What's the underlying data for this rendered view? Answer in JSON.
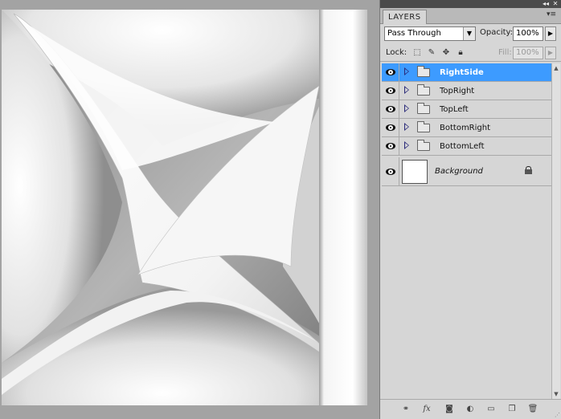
{
  "panel": {
    "collapse_icon": "double-chevron-left-icon",
    "close_icon": "close-icon",
    "tab_label": "LAYERS",
    "menu_icon": "panel-menu-icon"
  },
  "blend": {
    "mode": "Pass Through",
    "opacity_label": "Opacity:",
    "opacity_value": "100%"
  },
  "lock": {
    "label": "Lock:",
    "fill_label": "Fill:",
    "fill_value": "100%",
    "icons": [
      "lock-transparent-icon",
      "lock-image-icon",
      "lock-position-icon",
      "lock-all-icon"
    ]
  },
  "layers": [
    {
      "name": "RightSide",
      "type": "group",
      "selected": true,
      "visible": true
    },
    {
      "name": "TopRight",
      "type": "group",
      "selected": false,
      "visible": true
    },
    {
      "name": "TopLeft",
      "type": "group",
      "selected": false,
      "visible": true
    },
    {
      "name": "BottomRight",
      "type": "group",
      "selected": false,
      "visible": true
    },
    {
      "name": "BottomLeft",
      "type": "group",
      "selected": false,
      "visible": true
    }
  ],
  "background_layer": {
    "name": "Background",
    "locked": true
  },
  "bottom_bar": {
    "icons": [
      "link-layers-icon",
      "layer-style-fx-icon",
      "add-mask-icon",
      "adjustment-layer-icon",
      "new-group-icon",
      "new-layer-icon",
      "delete-layer-icon"
    ]
  },
  "colors": {
    "selection": "#3d9bff",
    "panel_bg": "#d6d6d6",
    "canvas_bg": "#a3a3a3"
  }
}
